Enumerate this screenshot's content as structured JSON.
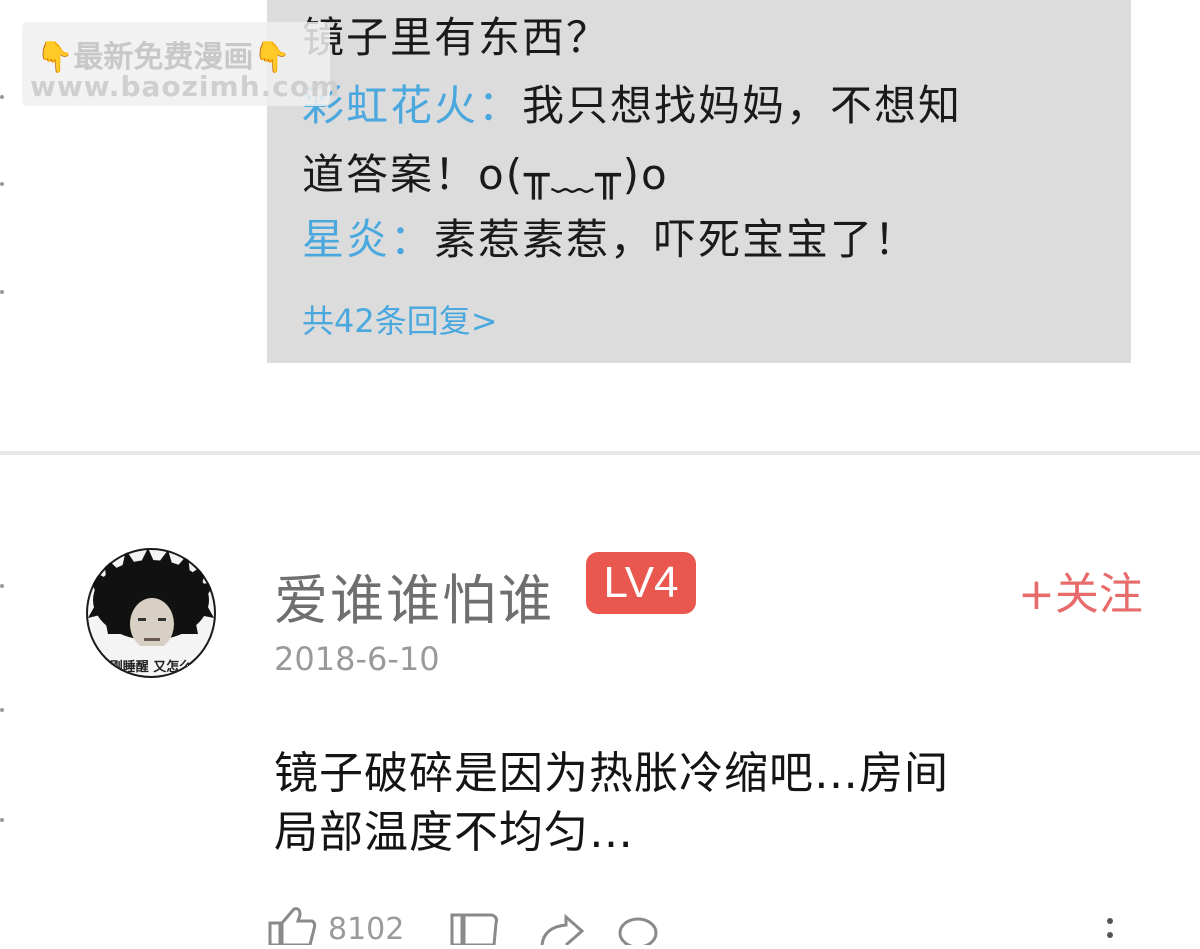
{
  "watermark": {
    "line1_hand_left": "👇",
    "line1_text": "最新免费漫画",
    "line1_hand_right": "👇",
    "line2": "www.baozimh.com"
  },
  "reply_box": {
    "line1": "镜子里有东西？",
    "replies": [
      {
        "name": "彩虹花火：",
        "text": "我只想找妈妈，不想知"
      },
      {
        "continuation": "道答案！o(╥﹏╥)o"
      },
      {
        "name": "星炎：",
        "text": "素惹素惹，吓死宝宝了！"
      }
    ],
    "more_link": "共42条回复>"
  },
  "comment": {
    "avatar_caption": "刚睡醒 又怎么",
    "username": "爱谁谁怕谁",
    "level": "LV4",
    "follow_label": "+关注",
    "date": "2018-6-10",
    "text_line1": "镜子破碎是因为热胀冷缩吧…房间",
    "text_line2": "局部温度不均匀…",
    "like_count": "8102",
    "icons": [
      "thumbs-up-icon",
      "thumbs-down-icon",
      "share-icon",
      "reply-icon",
      "more-icon"
    ]
  },
  "colors": {
    "reply_bg": "#dcdcdc",
    "link_blue": "#4aa8de",
    "badge_red": "#e9574e",
    "follow_red": "#e86b6b"
  }
}
